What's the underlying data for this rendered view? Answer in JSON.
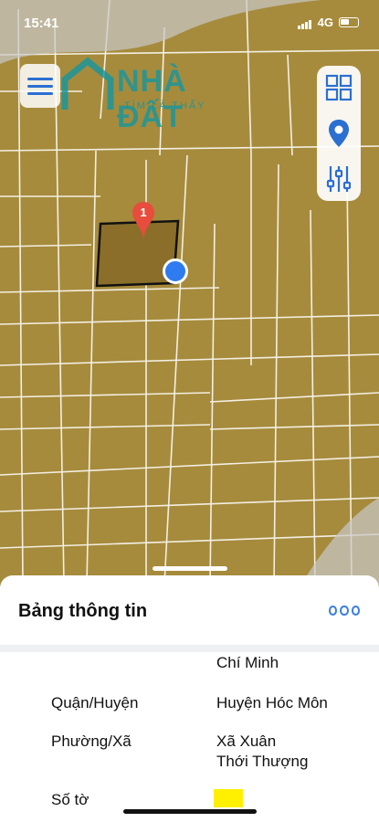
{
  "status_bar": {
    "time": "15:41",
    "network": "4G"
  },
  "logo": {
    "text": "NHÀ ĐẤT",
    "tagline": "TÌM LÀ THẤY"
  },
  "map": {
    "marker_label": "1"
  },
  "sheet": {
    "title": "Bảng thông tin",
    "rows": [
      {
        "label": "",
        "value": "Chí Minh"
      },
      {
        "label": "Quận/Huyện",
        "value": "Huyện Hóc Môn"
      },
      {
        "label": "Phường/Xã",
        "value": "Xã Xuân",
        "value2": "Thới Thượng"
      },
      {
        "label": "Số tờ",
        "value": ""
      }
    ]
  },
  "colors": {
    "map_bg": "#a68b3c",
    "plot": "#8a6e2a",
    "accent": "#2b6fd1"
  }
}
